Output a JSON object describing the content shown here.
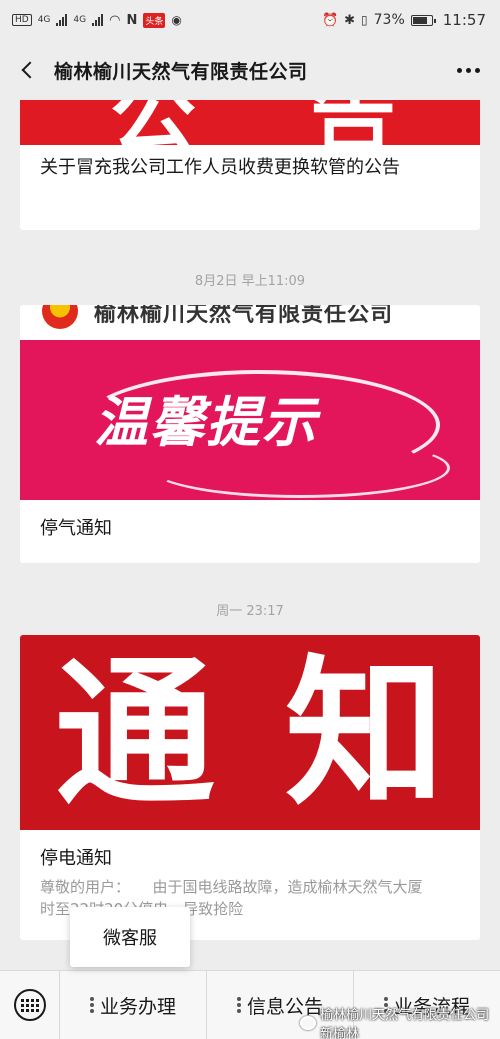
{
  "status_bar": {
    "left_badges": [
      "HD",
      "4G",
      "4G",
      "头条"
    ],
    "battery": "73%",
    "time": "11:57"
  },
  "navbar": {
    "title": "榆林榆川天然气有限责任公司"
  },
  "feed": {
    "card1": {
      "banner_glyphs": [
        "公",
        "告"
      ],
      "title": "关于冒充我公司工作人员收费更换软管的公告"
    },
    "timestamp1": "8月2日 早上11:09",
    "card2": {
      "header_text": "榆林榆川天然气有限责任公司",
      "banner_text": "温馨提示",
      "title": "停气通知"
    },
    "timestamp2": "周一 23:17",
    "card3": {
      "banner_glyphs": [
        "通",
        "知"
      ],
      "title": "停电通知",
      "description": "尊敬的用户：　　由于国电线路故障，造成榆林天然气大厦　　　　时至22时20分停电，导致抢险"
    }
  },
  "popup": {
    "label": "微客服"
  },
  "bottom_menu": {
    "items": [
      "业务办理",
      "信息公告",
      "业务流程"
    ]
  },
  "watermark": {
    "text": "榆林榆川天然气有限责任公司新榆林"
  }
}
